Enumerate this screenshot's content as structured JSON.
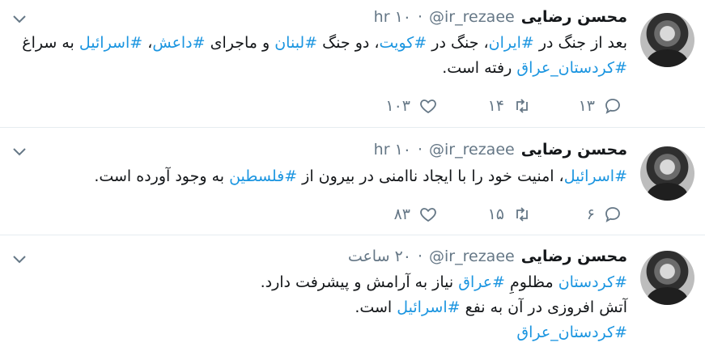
{
  "tweets": [
    {
      "name": "محسن رضایی",
      "handle": "@ir_rezaee",
      "dot": "·",
      "time": "۱۰ hr",
      "text": [
        {
          "t": "بعد از جنگ در ",
          "tag": false
        },
        {
          "t": "#ایران",
          "tag": true
        },
        {
          "t": "، جنگ در ",
          "tag": false
        },
        {
          "t": "#کویت",
          "tag": true
        },
        {
          "t": "، دو جنگ ",
          "tag": false
        },
        {
          "t": "#لبنان",
          "tag": true
        },
        {
          "t": " و ماجرای ",
          "tag": false
        },
        {
          "t": "#داعش",
          "tag": true
        },
        {
          "t": "، ",
          "tag": false
        },
        {
          "t": "#اسرائیل",
          "tag": true
        },
        {
          "t": " به سراغ ",
          "tag": false
        },
        {
          "t": "#کردستان_عراق",
          "tag": true
        },
        {
          "t": " رفته است.",
          "tag": false
        }
      ],
      "replies": "۱۳",
      "retweets": "۱۴",
      "likes": "۱۰۳"
    },
    {
      "name": "محسن رضایی",
      "handle": "@ir_rezaee",
      "dot": "·",
      "time": "۱۰ hr",
      "text": [
        {
          "t": "#اسرائیل",
          "tag": true
        },
        {
          "t": "، امنیت خود را با ایجاد ناامنی در بیرون از ",
          "tag": false
        },
        {
          "t": "#فلسطین",
          "tag": true
        },
        {
          "t": " به وجود آورده است.",
          "tag": false
        }
      ],
      "replies": "۶",
      "retweets": "۱۵",
      "likes": "۸۳"
    },
    {
      "name": "محسن رضایی",
      "handle": "@ir_rezaee",
      "dot": "·",
      "time": "۲۰ ساعت",
      "text": [
        {
          "t": "#کردستان",
          "tag": true
        },
        {
          "t": " مظلومِ ",
          "tag": false
        },
        {
          "t": "#عراق",
          "tag": true
        },
        {
          "t": " نیاز به آرامش و پیشرفت دارد.",
          "tag": false
        },
        {
          "t": "\n",
          "tag": false
        },
        {
          "t": "آتش افروزی در آن به نفع ",
          "tag": false
        },
        {
          "t": "#اسرائیل",
          "tag": true
        },
        {
          "t": " است.",
          "tag": false
        },
        {
          "t": "\n",
          "tag": false
        },
        {
          "t": "#کردستان_عراق",
          "tag": true
        }
      ]
    }
  ],
  "icons": {
    "caret": "chevron-down-icon",
    "reply": "reply-icon",
    "retweet": "retweet-icon",
    "like": "heart-icon"
  },
  "colors": {
    "hashtag": "#1b95e0",
    "muted": "#657786",
    "text": "#14171a"
  }
}
